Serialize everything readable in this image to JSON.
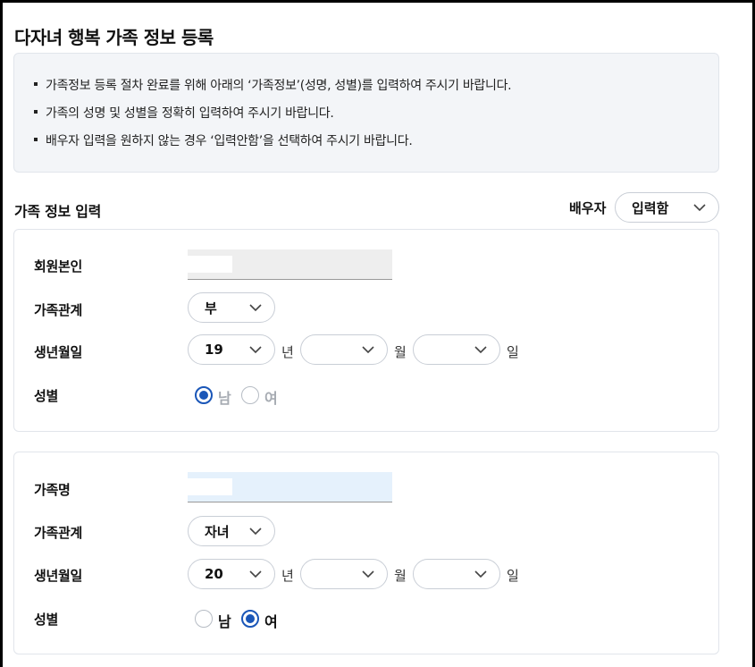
{
  "page": {
    "title": "다자녀 행복 가족 정보 등록"
  },
  "notice": {
    "items": [
      "가족정보 등록 절차 완료를 위해 아래의 ‘가족정보’(성명, 성별)를 입력하여 주시기 바랍니다.",
      "가족의 성명 및 성별을 정확히 입력하여 주시기 바랍니다.",
      "배우자 입력을 원하지 않는 경우 ‘입력안함’을 선택하여 주시기 바랍니다."
    ]
  },
  "section": {
    "title": "가족 정보 입력",
    "spouse_label": "배우자",
    "spouse_select_value": "입력함"
  },
  "cards": [
    {
      "name_label": "회원본인",
      "name_value": "",
      "relation_label": "가족관계",
      "relation_value": "부",
      "birth_label": "생년월일",
      "birth_year": "19",
      "year_unit": "년",
      "birth_month": "",
      "month_unit": "월",
      "birth_day": "",
      "day_unit": "일",
      "gender_label": "성별",
      "gender_male": "남",
      "gender_female": "여",
      "gender_selected": "male"
    },
    {
      "name_label": "가족명",
      "name_value": "",
      "relation_label": "가족관계",
      "relation_value": "자녀",
      "birth_label": "생년월일",
      "birth_year": "20",
      "year_unit": "년",
      "birth_month": "",
      "month_unit": "월",
      "birth_day": "",
      "day_unit": "일",
      "gender_label": "성별",
      "gender_male": "남",
      "gender_female": "여",
      "gender_selected": "female"
    }
  ],
  "colors": {
    "accent": "#1a56b8",
    "notice_bg": "#f3f5f8",
    "name_readonly_bg": "#eeeeee",
    "name_input_bg": "#e5f1fc"
  }
}
